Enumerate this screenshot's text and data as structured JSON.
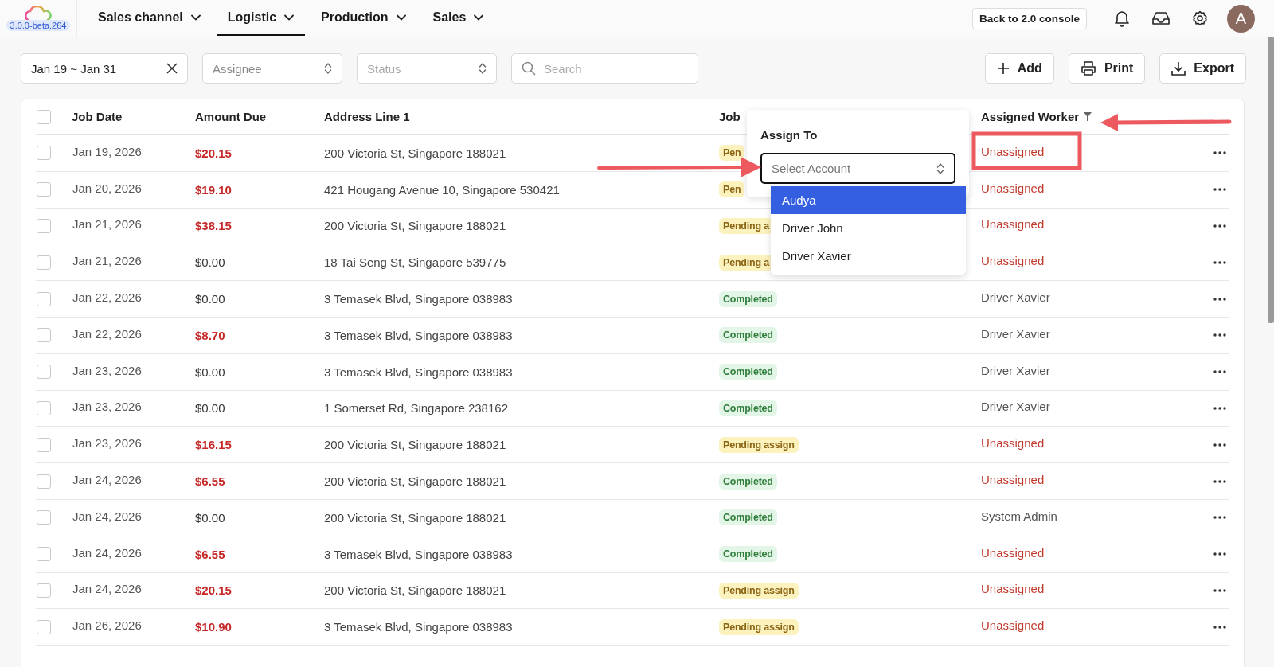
{
  "logo": {
    "version": "3.0.0-beta.264"
  },
  "nav": [
    {
      "label": "Sales channel",
      "selected": false
    },
    {
      "label": "Logistic",
      "selected": true
    },
    {
      "label": "Production",
      "selected": false
    },
    {
      "label": "Sales",
      "selected": false
    }
  ],
  "header_actions": {
    "console_button": "Back to 2.0 console",
    "avatar": "A"
  },
  "filters": {
    "date_range": "Jan 19 ~ Jan 31",
    "assignee": {
      "placeholder": "Assignee"
    },
    "status": {
      "placeholder": "Status"
    },
    "search": {
      "placeholder": "Search"
    }
  },
  "toolbar_buttons": [
    {
      "kind": "add",
      "label": "Add"
    },
    {
      "kind": "print",
      "label": "Print"
    },
    {
      "kind": "export",
      "label": "Export"
    }
  ],
  "table": {
    "all_checked": false,
    "columns": [
      "Job Date",
      "Amount Due",
      "Address Line 1",
      "Job",
      "Assigned Worker"
    ],
    "rows": [
      {
        "checked": false,
        "date": "Jan 19, 2026",
        "amount": "$20.15",
        "outstanding": true,
        "address": "200 Victoria St, Singapore 188021",
        "status": "Pen",
        "kind": "pending",
        "worker": "Unassigned",
        "unassigned": true
      },
      {
        "checked": false,
        "date": "Jan 20, 2026",
        "amount": "$19.10",
        "outstanding": true,
        "address": "421 Hougang Avenue 10, Singapore 530421",
        "status": "Pen",
        "kind": "pending",
        "worker": "Unassigned",
        "unassigned": true
      },
      {
        "checked": false,
        "date": "Jan 21, 2026",
        "amount": "$38.15",
        "outstanding": true,
        "address": "200 Victoria St, Singapore 188021",
        "status": "Pending a",
        "kind": "pending",
        "worker": "Unassigned",
        "unassigned": true
      },
      {
        "checked": false,
        "date": "Jan 21, 2026",
        "amount": "$0.00",
        "outstanding": false,
        "address": "18 Tai Seng St, Singapore 539775",
        "status": "Pending a",
        "kind": "pending",
        "worker": "Unassigned",
        "unassigned": true
      },
      {
        "checked": false,
        "date": "Jan 22, 2026",
        "amount": "$0.00",
        "outstanding": false,
        "address": "3 Temasek Blvd, Singapore 038983",
        "status": "Completed",
        "kind": "completed",
        "worker": "Driver Xavier",
        "unassigned": false
      },
      {
        "checked": false,
        "date": "Jan 22, 2026",
        "amount": "$8.70",
        "outstanding": true,
        "address": "3 Temasek Blvd, Singapore 038983",
        "status": "Completed",
        "kind": "completed",
        "worker": "Driver Xavier",
        "unassigned": false
      },
      {
        "checked": false,
        "date": "Jan 23, 2026",
        "amount": "$0.00",
        "outstanding": false,
        "address": "3 Temasek Blvd, Singapore 038983",
        "status": "Completed",
        "kind": "completed",
        "worker": "Driver Xavier",
        "unassigned": false
      },
      {
        "checked": false,
        "date": "Jan 23, 2026",
        "amount": "$0.00",
        "outstanding": false,
        "address": "1 Somerset Rd, Singapore 238162",
        "status": "Completed",
        "kind": "completed",
        "worker": "Driver Xavier",
        "unassigned": false
      },
      {
        "checked": false,
        "date": "Jan 23, 2026",
        "amount": "$16.15",
        "outstanding": true,
        "address": "200 Victoria St, Singapore 188021",
        "status": "Pending assign",
        "kind": "pending",
        "worker": "Unassigned",
        "unassigned": true
      },
      {
        "checked": false,
        "date": "Jan 24, 2026",
        "amount": "$6.55",
        "outstanding": true,
        "address": "200 Victoria St, Singapore 188021",
        "status": "Completed",
        "kind": "completed",
        "worker": "Unassigned",
        "unassigned": true
      },
      {
        "checked": false,
        "date": "Jan 24, 2026",
        "amount": "$0.00",
        "outstanding": false,
        "address": "200 Victoria St, Singapore 188021",
        "status": "Completed",
        "kind": "completed",
        "worker": "System Admin",
        "unassigned": false
      },
      {
        "checked": false,
        "date": "Jan 24, 2026",
        "amount": "$6.55",
        "outstanding": true,
        "address": "3 Temasek Blvd, Singapore 038983",
        "status": "Completed",
        "kind": "completed",
        "worker": "Unassigned",
        "unassigned": true
      },
      {
        "checked": false,
        "date": "Jan 24, 2026",
        "amount": "$20.15",
        "outstanding": true,
        "address": "200 Victoria St, Singapore 188021",
        "status": "Pending assign",
        "kind": "pending",
        "worker": "Unassigned",
        "unassigned": true
      },
      {
        "checked": false,
        "date": "Jan 26, 2026",
        "amount": "$10.90",
        "outstanding": true,
        "address": "3 Temasek Blvd, Singapore 038983",
        "status": "Pending assign",
        "kind": "pending",
        "worker": "Unassigned",
        "unassigned": true
      }
    ]
  },
  "assign_popover": {
    "title": "Assign To",
    "select": {
      "placeholder": "Select Account"
    },
    "options": [
      {
        "label": "Audya",
        "selected": true
      },
      {
        "label": "Driver John",
        "selected": false
      },
      {
        "label": "Driver Xavier",
        "selected": false
      }
    ]
  }
}
